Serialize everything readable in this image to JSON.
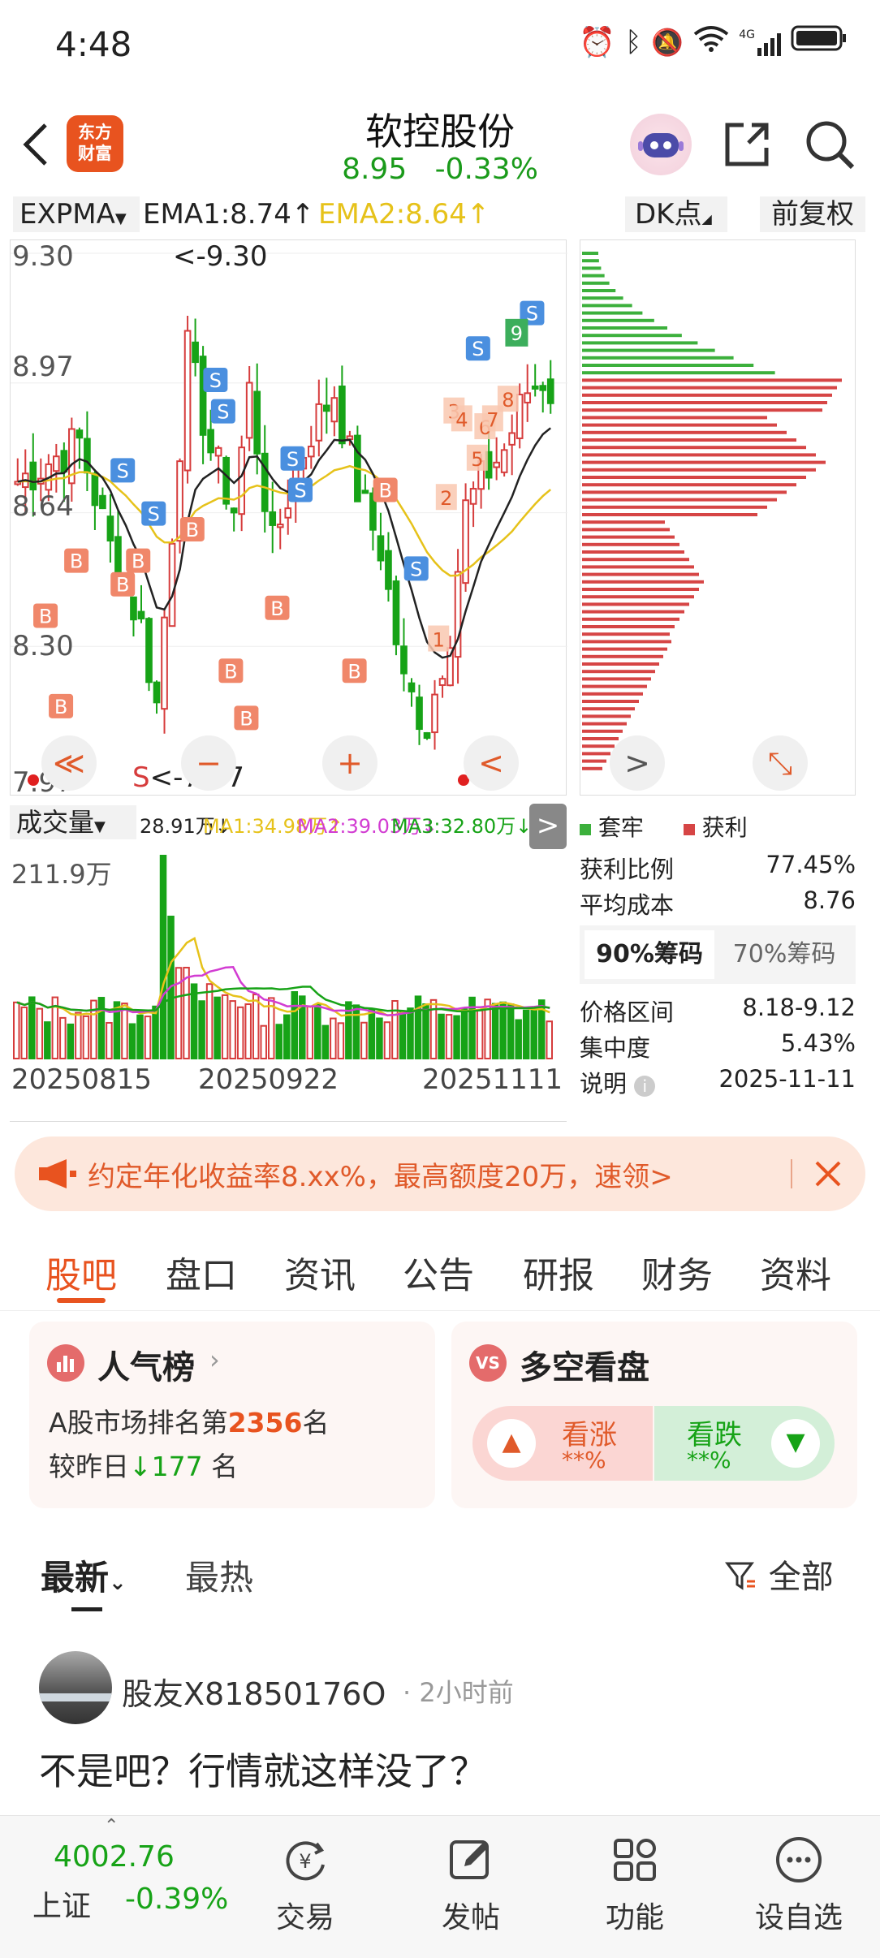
{
  "status_bar": {
    "time": "4:48",
    "network": "4G"
  },
  "header": {
    "app_logo_text": "东方\n财富",
    "title": "软控股份",
    "price": "8.95",
    "change_pct": "-0.33%"
  },
  "chart_toolbar": {
    "indicator_select": "EXPMA",
    "ema1": "EMA1:8.74↑",
    "ema2": "EMA2:8.64↑",
    "dk_select": "DK点",
    "fq_button": "前复权"
  },
  "kline": {
    "price_labels": [
      "9.30",
      "8.97",
      "8.64",
      "8.30",
      "7.97"
    ],
    "high_marker": "<-9.30",
    "low_marker": "<-7.97",
    "low_marker_prefix": "S",
    "colors": {
      "up": "#d63c3c",
      "down": "#17a317",
      "ema1": "#222222",
      "ema2": "#e6c21a",
      "b_signal": "#f0876a",
      "s_signal": "#4a8fdf"
    },
    "signals": {
      "buy": "B",
      "sell": "S",
      "nine": "9",
      "counts": [
        "1",
        "2",
        "3",
        "4",
        "5",
        "6",
        "7",
        "8"
      ]
    }
  },
  "chart_controls": {
    "left": "≪",
    "minus": "−",
    "plus": "+",
    "prev": "<",
    "next": ">",
    "expand": "⤡"
  },
  "chip": {
    "legend_trapped": "套牢",
    "legend_profit": "获利",
    "rows": [
      {
        "label": "获利比例",
        "value": "77.45%"
      },
      {
        "label": "平均成本",
        "value": "8.76"
      }
    ],
    "tabs": [
      "90%筹码",
      "70%筹码"
    ],
    "rows2": [
      {
        "label": "价格区间",
        "value": "8.18-9.12"
      },
      {
        "label": "集中度",
        "value": "5.43%"
      },
      {
        "label": "说明",
        "value": "2025-11-11"
      }
    ]
  },
  "volume": {
    "select": "成交量",
    "vol": "28.91万↓",
    "ma1": "MA1:34.98万↑",
    "ma2": "MA2:39.03万↓",
    "ma3": "MA3:32.80万↓",
    "max_label": "211.9万",
    "dates": [
      "20250815",
      "20250922",
      "20251111"
    ],
    "colors": {
      "ma1": "#e6c21a",
      "ma2": "#d23cd2",
      "ma3": "#17a317"
    }
  },
  "banner": {
    "text": "约定年化收益率8.xx%，最高额度20万，速领>"
  },
  "tabs": [
    "股吧",
    "盘口",
    "资讯",
    "公告",
    "研报",
    "财务",
    "资料"
  ],
  "popularity_card": {
    "title": "人气榜",
    "rank_prefix": "A股市场排名第",
    "rank": "2356",
    "rank_suffix": "名",
    "change_prefix": "较昨日",
    "change": "177",
    "change_suffix": "名"
  },
  "sentiment_card": {
    "title": "多空看盘",
    "bull_label": "看涨",
    "bull_value": "**%",
    "bear_label": "看跌",
    "bear_value": "**%"
  },
  "feed_filter": {
    "latest": "最新",
    "hot": "最热",
    "all": "全部"
  },
  "post": {
    "username": "股友X81850176O",
    "time": "2小时前",
    "content": "不是吧？行情就这样没了？"
  },
  "bottom_nav": {
    "index_value": "4002.76",
    "index_name": "上证",
    "index_change": "-0.39%",
    "items": [
      "交易",
      "发帖",
      "功能",
      "设自选"
    ]
  }
}
